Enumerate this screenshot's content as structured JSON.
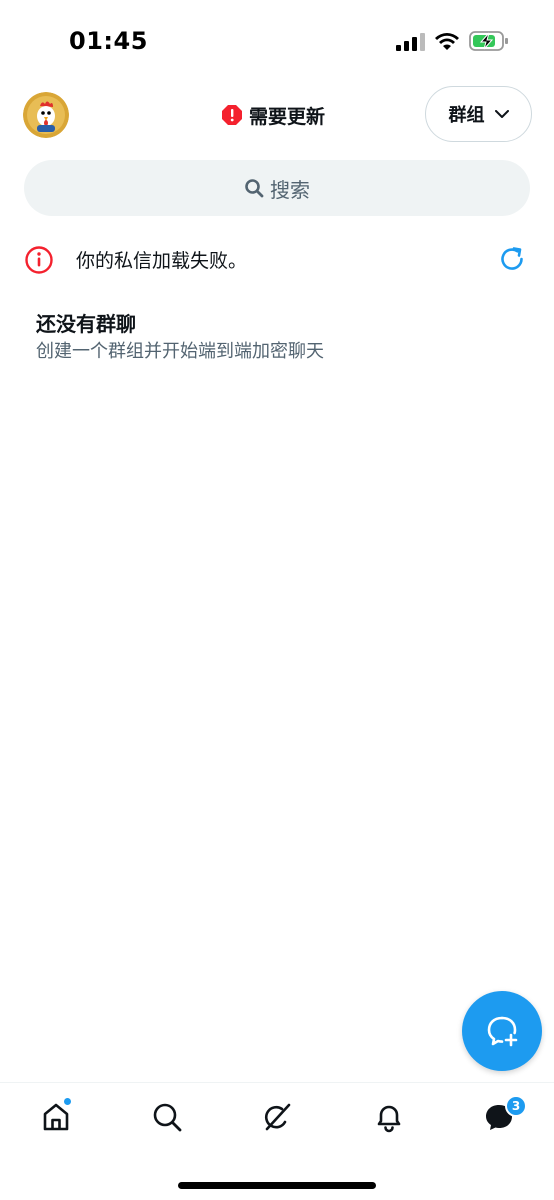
{
  "status_bar": {
    "time": "01:45"
  },
  "header": {
    "update_label": "需要更新",
    "group_dropdown_label": "群组"
  },
  "search": {
    "placeholder": "搜索"
  },
  "error_banner": {
    "text": "你的私信加载失败。"
  },
  "empty_state": {
    "title": "还没有群聊",
    "subtitle": "创建一个群组并开始端到端加密聊天"
  },
  "bottom_nav": {
    "items": [
      {
        "icon": "home-icon",
        "active_dot": true
      },
      {
        "icon": "search-icon"
      },
      {
        "icon": "grok-icon"
      },
      {
        "icon": "bell-icon"
      },
      {
        "icon": "messages-icon"
      }
    ],
    "messages_badge": "3"
  },
  "colors": {
    "accent": "#1d9bf0",
    "error": "#f4212e",
    "text_primary": "#0f1419",
    "text_secondary": "#536471",
    "search_bg": "#eff3f4"
  }
}
